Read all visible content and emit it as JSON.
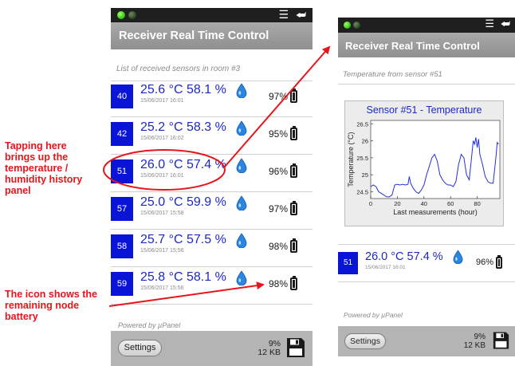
{
  "colors": {
    "accent_blue": "#1c28c8",
    "id_box_blue": "#0a14d6",
    "annotation_red": "#e8141b",
    "titlebar_gray": "#9a9a9a",
    "bottombar_gray": "#b4b4b4"
  },
  "annotations": {
    "left_top": "Tapping here\nbrings up the\ntemperature /\nhumidity history\npanel",
    "left_bottom": "The icon shows the\nremaining node\nbattery"
  },
  "phone_a": {
    "statusbar": {
      "menu_icon": "menu-icon",
      "back_icon": "back-arrow-icon"
    },
    "title": "Receiver Real Time Control",
    "list_caption": "List of received sensors in room #3",
    "sensors": [
      {
        "id": "40",
        "reading": "25.6 °C   58.1 %",
        "date": "15/06/2017 16:01",
        "battery": "97%",
        "battery_level": 0.97
      },
      {
        "id": "42",
        "reading": "25.2 °C   58.3 %",
        "date": "15/06/2017 16:02",
        "battery": "95%",
        "battery_level": 0.95
      },
      {
        "id": "51",
        "reading": "26.0 °C   57.4 %",
        "date": "15/06/2017 16:01",
        "battery": "96%",
        "battery_level": 0.96
      },
      {
        "id": "57",
        "reading": "25.0 °C   59.9 %",
        "date": "15/06/2017 15:58",
        "battery": "97%",
        "battery_level": 0.97
      },
      {
        "id": "58",
        "reading": "25.7 °C   57.5 %",
        "date": "15/06/2017 15:56",
        "battery": "98%",
        "battery_level": 0.98
      },
      {
        "id": "59",
        "reading": "25.8 °C   58.1 %",
        "date": "15/06/2017 15:56",
        "battery": "98%",
        "battery_level": 0.98
      }
    ],
    "powered_by": "Powered by µPanel",
    "settings_label": "Settings",
    "usage_percent": "9%",
    "usage_size": "12 KB",
    "save_icon": "floppy-disk-icon"
  },
  "phone_b": {
    "title": "Receiver Real Time Control",
    "caption": "Temperature from sensor #51",
    "chart_data": {
      "type": "line",
      "title": "Sensor #51 - Temperature",
      "xlabel": "Last measurements (hour)",
      "ylabel": "Temperature (°C)",
      "xlim": [
        0,
        97
      ],
      "ylim": [
        24.3,
        26.6
      ],
      "xticks": [
        "0",
        "20",
        "40",
        "60",
        "80"
      ],
      "yticks": [
        "24.5",
        "25",
        "25.5",
        "26",
        "26.5"
      ],
      "grid": false,
      "series": [
        {
          "x": [
            0,
            2,
            4,
            6,
            8,
            10,
            12,
            14,
            16,
            18,
            20,
            22,
            24,
            26,
            28,
            29,
            30,
            32,
            34,
            36,
            38,
            40,
            42,
            44,
            46,
            48,
            50,
            52,
            54,
            56,
            58,
            60,
            62,
            64,
            66,
            68,
            70,
            72,
            74,
            76,
            77,
            78,
            79,
            80,
            81,
            82,
            84,
            86,
            88,
            90,
            92,
            94,
            95,
            96
          ],
          "values": [
            24.65,
            24.7,
            24.65,
            24.5,
            24.45,
            24.4,
            24.35,
            24.35,
            24.4,
            24.7,
            24.72,
            24.7,
            24.72,
            24.7,
            24.72,
            24.95,
            24.75,
            24.6,
            24.5,
            24.45,
            24.55,
            24.7,
            25.0,
            25.25,
            25.5,
            25.6,
            25.4,
            25.0,
            24.85,
            24.75,
            24.7,
            24.7,
            24.65,
            24.8,
            25.3,
            25.6,
            25.5,
            25.0,
            24.85,
            25.6,
            26.0,
            25.9,
            26.1,
            25.8,
            26.05,
            25.6,
            25.3,
            24.95,
            24.8,
            24.75,
            24.75,
            25.5,
            25.95,
            25.9
          ]
        }
      ]
    },
    "sensor": {
      "id": "51",
      "reading": "26.0 °C   57.4 %",
      "date": "15/06/2017 16:01",
      "battery": "96%",
      "battery_level": 0.96
    },
    "powered_by": "Powered by µPanel",
    "settings_label": "Settings",
    "usage_percent": "9%",
    "usage_size": "12 KB",
    "save_icon": "floppy-disk-icon"
  }
}
